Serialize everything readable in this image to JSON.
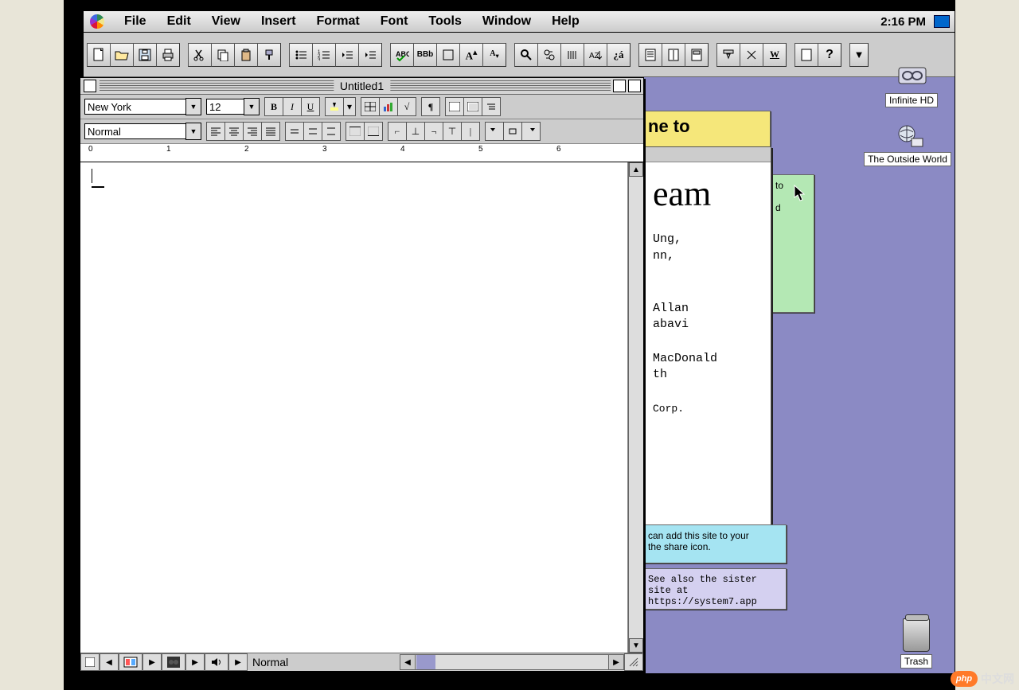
{
  "menubar": {
    "items": [
      "File",
      "Edit",
      "View",
      "Insert",
      "Format",
      "Font",
      "Tools",
      "Window",
      "Help"
    ],
    "clock": "2:16 PM"
  },
  "document": {
    "title": "Untitled1",
    "font_name": "New York",
    "font_size": "12",
    "style": "Normal",
    "status_style": "Normal",
    "ruler_marks": [
      "0",
      "1",
      "2",
      "3",
      "4",
      "5",
      "6"
    ]
  },
  "notes": {
    "yellow_line1": "ne to",
    "green_line1": "to",
    "green_line2": "d",
    "cyan_line1": "can add this site to your",
    "cyan_line2": "the share icon.",
    "lav_line1": "See also the sister site at",
    "lav_line2": "https://system7.app"
  },
  "textwin": {
    "heading_suffix": "eam",
    "line1": "Ung,",
    "line2": "nn,",
    "line3": "Allan",
    "line4": "abavi",
    "line5": "MacDonald",
    "line6": "th",
    "line7": "Corp."
  },
  "desktop": {
    "infinite": "Infinite HD",
    "outside": "The Outside World",
    "trash": "Trash"
  },
  "watermark": {
    "brand": "php",
    "text": "中文网"
  }
}
